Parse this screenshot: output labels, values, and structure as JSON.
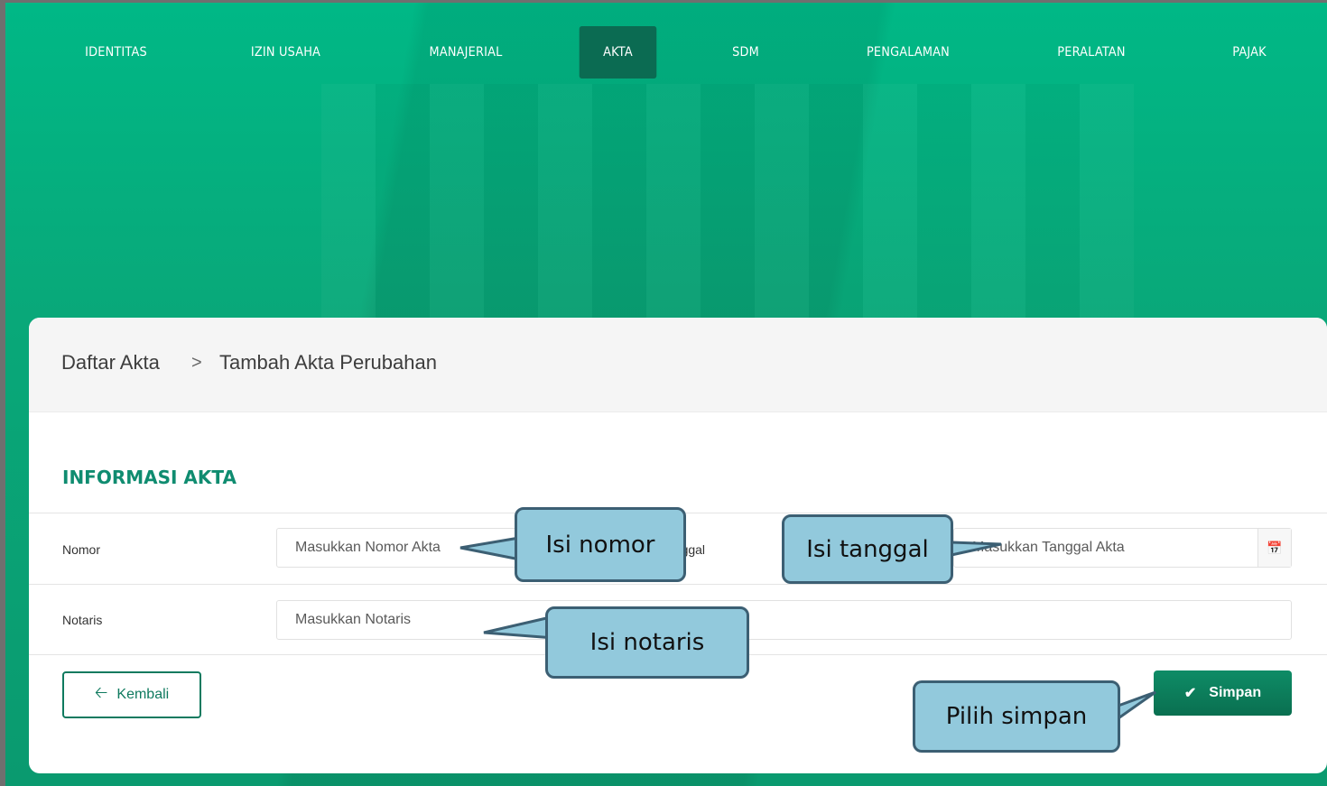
{
  "nav": {
    "items": [
      "IDENTITAS",
      "IZIN USAHA",
      "MANAJERIAL",
      "AKTA",
      "SDM",
      "PENGALAMAN",
      "PERALATAN",
      "PAJAK"
    ],
    "active": "AKTA"
  },
  "breadcrumb": {
    "parent": "Daftar Akta",
    "separator": ">",
    "current": "Tambah Akta Perubahan"
  },
  "form": {
    "section_title": "INFORMASI AKTA",
    "nomor_label": "Nomor",
    "nomor_placeholder": "Masukkan Nomor Akta",
    "tanggal_label": "Tanggal",
    "tanggal_placeholder": "Masukkan Tanggal Akta",
    "notaris_label": "Notaris",
    "notaris_placeholder": "Masukkan Notaris"
  },
  "buttons": {
    "back_label": "Kembali",
    "save_label": "Simpan"
  },
  "callouts": {
    "nomor": "Isi nomor",
    "tanggal": "Isi tanggal",
    "notaris": "Isi notaris",
    "simpan": "Pilih simpan"
  },
  "colors": {
    "header_green": "#00b886",
    "active_tab": "#0b6b52",
    "accent": "#0f8c70",
    "callout_fill": "#92c9dc",
    "callout_border": "#3c5f73"
  },
  "icons": {
    "back": "arrow-left-icon",
    "save": "check-icon",
    "calendar": "calendar-icon"
  }
}
